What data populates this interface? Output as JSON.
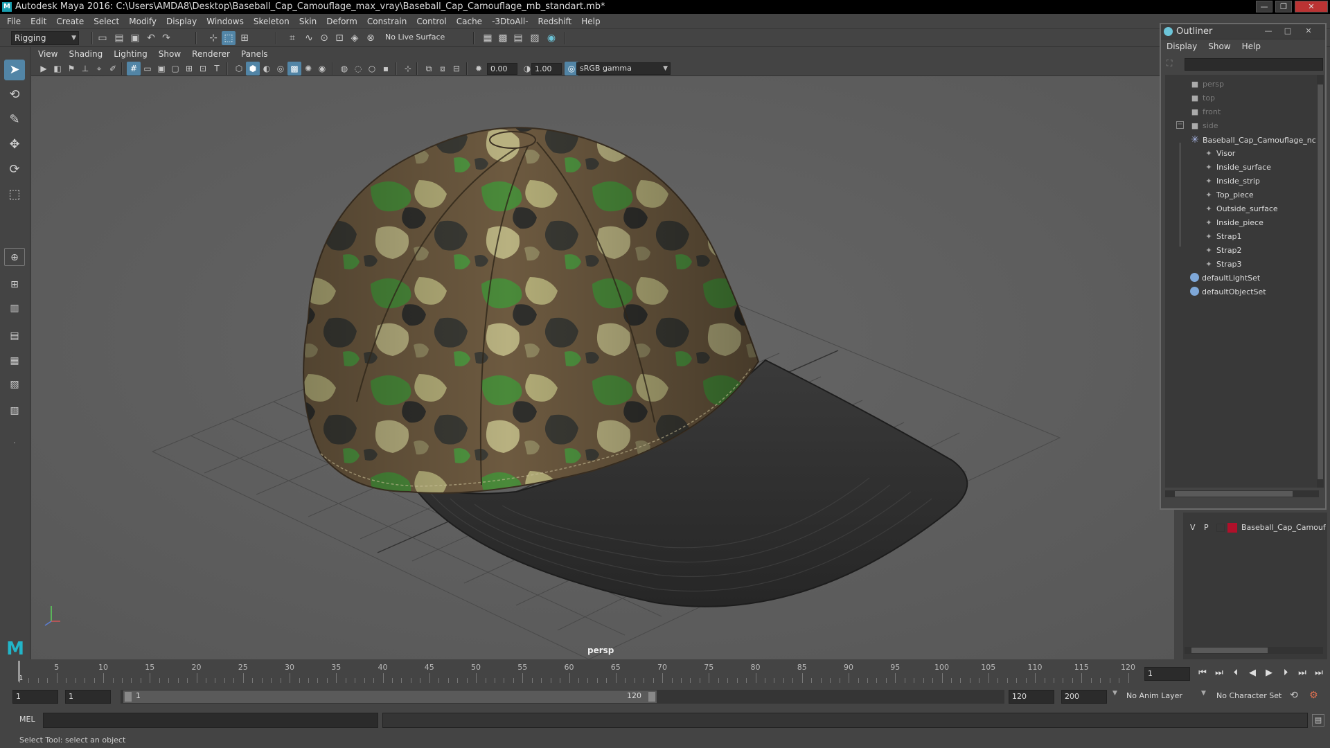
{
  "window": {
    "title": "Autodesk Maya 2016: C:\\Users\\AMDA8\\Desktop\\Baseball_Cap_Camouflage_max_vray\\Baseball_Cap_Camouflage_mb_standart.mb*",
    "min": "—",
    "max": "❐",
    "close": "✕"
  },
  "menubar": [
    "File",
    "Edit",
    "Create",
    "Select",
    "Modify",
    "Display",
    "Windows",
    "Skeleton",
    "Skin",
    "Deform",
    "Constrain",
    "Control",
    "Cache",
    "-3DtoAll-",
    "Redshift",
    "Help"
  ],
  "statusline": {
    "mode": "Rigging",
    "live_surface": "No Live Surface"
  },
  "viewport": {
    "menu": [
      "View",
      "Shading",
      "Lighting",
      "Show",
      "Renderer",
      "Panels"
    ],
    "exposure": "0.00",
    "gamma": "1.00",
    "color_space": "sRGB gamma",
    "camera_label": "persp"
  },
  "outliner": {
    "title": "Outliner",
    "menu": [
      "Display",
      "Show",
      "Help"
    ],
    "items": [
      {
        "label": "persp",
        "kind": "camera"
      },
      {
        "label": "top",
        "kind": "camera"
      },
      {
        "label": "front",
        "kind": "camera"
      },
      {
        "label": "side",
        "kind": "camera"
      },
      {
        "label": "Baseball_Cap_Camouflage_nc",
        "kind": "group"
      },
      {
        "label": "Visor",
        "kind": "mesh"
      },
      {
        "label": "Inside_surface",
        "kind": "mesh"
      },
      {
        "label": "Inside_strip",
        "kind": "mesh"
      },
      {
        "label": "Top_piece",
        "kind": "mesh"
      },
      {
        "label": "Outside_surface",
        "kind": "mesh"
      },
      {
        "label": "Inside_piece",
        "kind": "mesh"
      },
      {
        "label": "Strap1",
        "kind": "mesh"
      },
      {
        "label": "Strap2",
        "kind": "mesh"
      },
      {
        "label": "Strap3",
        "kind": "mesh"
      },
      {
        "label": "defaultLightSet",
        "kind": "set"
      },
      {
        "label": "defaultObjectSet",
        "kind": "set"
      }
    ]
  },
  "layer": {
    "v": "V",
    "p": "P",
    "name": "Baseball_Cap_Camouf",
    "color": "#b0102a"
  },
  "timeline": {
    "ticks": [
      "5",
      "10",
      "15",
      "20",
      "25",
      "30",
      "35",
      "40",
      "45",
      "50",
      "55",
      "60",
      "65",
      "70",
      "75",
      "80",
      "85",
      "90",
      "95",
      "100",
      "105",
      "110",
      "115",
      "120"
    ],
    "start_marker": "1",
    "current_frame": "1"
  },
  "range": {
    "start": "1",
    "playback_start": "1",
    "slider_start": "1",
    "slider_end": "120",
    "playback_end": "120",
    "end": "200",
    "anim_layer": "No Anim Layer",
    "character_set": "No Character Set"
  },
  "cmdline": {
    "lang": "MEL"
  },
  "help_line": "Select Tool: select an object",
  "colors": {
    "accent": "#5285a6",
    "viewport_bg": "#5d5d5d",
    "panel": "#444444"
  }
}
